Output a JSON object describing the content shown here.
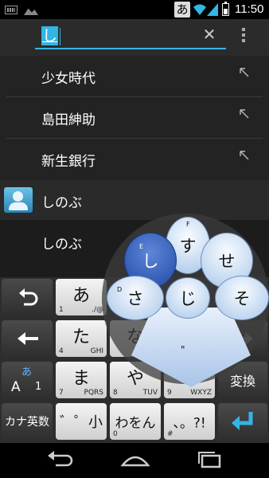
{
  "status_bar": {
    "ime_badge": "あ",
    "time": "11:50",
    "icons": [
      "keyboard-icon",
      "image-icon",
      "wifi-icon",
      "signal-icon",
      "battery-icon"
    ]
  },
  "search": {
    "query": "し",
    "clear_icon": "close-icon",
    "menu_icon": "overflow-menu-icon"
  },
  "suggestions": [
    {
      "text": "少女時代"
    },
    {
      "text": "島田紳助"
    },
    {
      "text": "新生銀行"
    }
  ],
  "contacts": {
    "header": "しのぶ",
    "result": "しのぶ"
  },
  "keyboard": {
    "row1": {
      "key": "あ",
      "sub_left": "1",
      "sub_right": "./@"
    },
    "row2": {
      "key": "た",
      "sub_left": "4",
      "sub_right": "GHI"
    },
    "row2_mid": {
      "key": "な"
    },
    "row3": {
      "key": "ま",
      "sub_left": "7",
      "sub_right": "PQRS"
    },
    "row3_mid": {
      "key": "や",
      "sub_left": "8",
      "sub_right": "TUV"
    },
    "row3_right": {
      "sub_left": "9",
      "sub_right": "WXYZ"
    },
    "convert": "変換",
    "kana_eisu": "カナ英数",
    "dakuten_key": "゛゜小",
    "wawon_key": "わをん",
    "wawon_sub": "0",
    "punct_key": "、。?!",
    "punct_sub": "#",
    "mode_key": {
      "top": "あ",
      "left": "A",
      "right": "1"
    }
  },
  "flick": {
    "center": "じ",
    "up": "す",
    "up_hint": "F",
    "left": "さ",
    "left_hint": "D",
    "upper_left": "し",
    "upper_left_hint": "E",
    "upper_right": "せ",
    "right": "そ",
    "down_hint": "\""
  },
  "colors": {
    "accent": "#33b5e5",
    "flick_active": "#1f4aa5"
  }
}
